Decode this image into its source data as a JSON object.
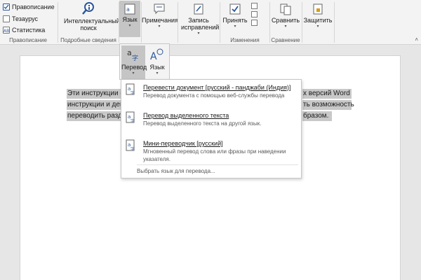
{
  "ribbon": {
    "proofing": {
      "spelling": "Правописание",
      "thesaurus": "Тезаурус",
      "stats": "Статистика",
      "label": "Правописание"
    },
    "insights": {
      "smart_lookup": "Интеллектуальный поиск",
      "label": "Подробные сведения"
    },
    "language_button": "Язык",
    "comments_button": "Примечания",
    "tracking": {
      "record_button": "Запись исправлений"
    },
    "changes": {
      "accept_button": "Принять",
      "label": "Изменения"
    },
    "compare": {
      "compare_button": "Сравнить",
      "label": "Сравнение"
    },
    "protect_button": "Защитить"
  },
  "language_dropdown": {
    "translate_label": "Перевод",
    "language_label": "Язык"
  },
  "translate_menu": {
    "items": [
      {
        "title": "Перевести документ [русский - панджаби (Индия)]",
        "description": "Перевод документа с помощью веб-службы перевода"
      },
      {
        "title": "Перевод выделенного текста",
        "description": "Перевод выделенного текста на другой язык."
      },
      {
        "title": "Мини-переводчик [русский]",
        "description": "Мгновенный перевод слова или фразы при наведении указателя."
      }
    ],
    "choose_language": "Выбрать язык для перевода..."
  },
  "document": {
    "lines": [
      {
        "left": "Эти инструкции с",
        "right": "х версий Word"
      },
      {
        "left": "инструкции и дей",
        "right": "ть возможность"
      },
      {
        "left": "переводить разде",
        "right": "бразом."
      }
    ]
  },
  "colors": {
    "accent": "#2b579a",
    "selection": "#c8c8c8",
    "ribbon_bg": "#f3f3f3"
  }
}
